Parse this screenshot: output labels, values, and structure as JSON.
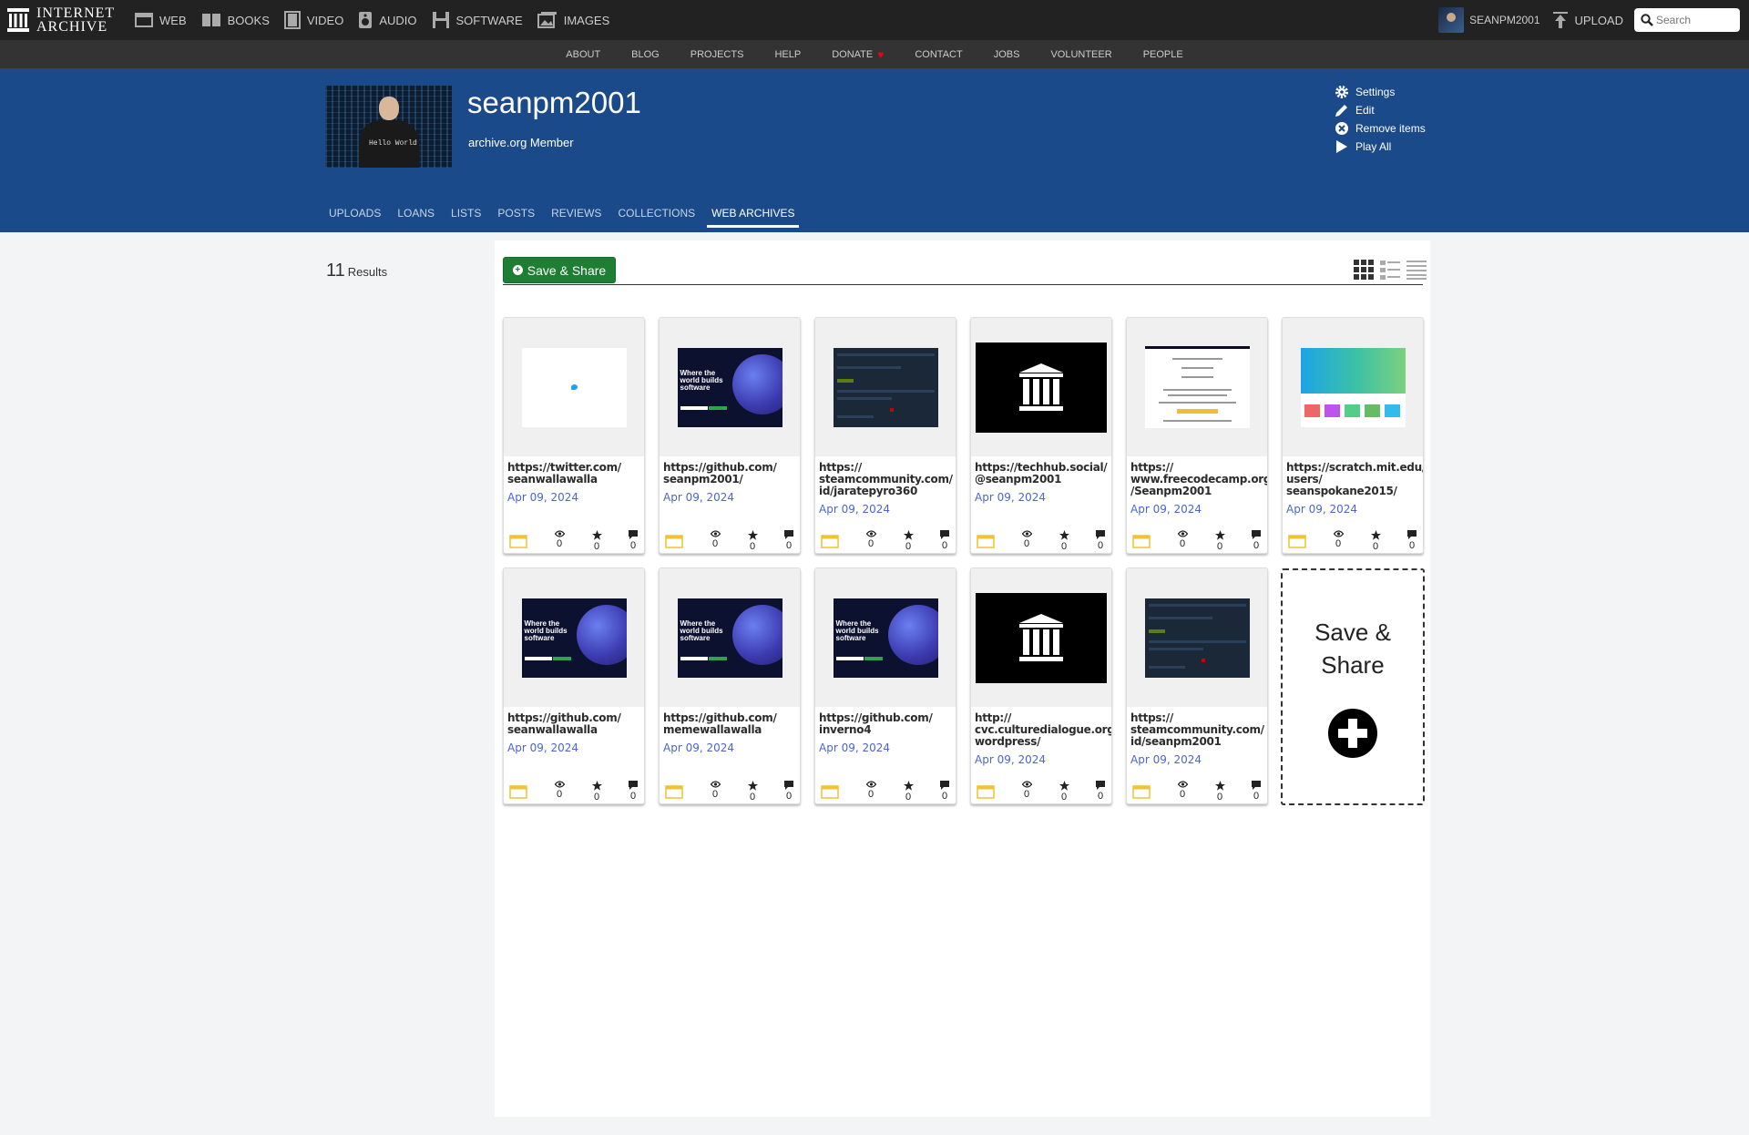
{
  "topnav": {
    "logo_line1": "INTERNET",
    "logo_line2": "ARCHIVE",
    "mediatypes": [
      {
        "label": "WEB",
        "icon": "web-icon"
      },
      {
        "label": "BOOKS",
        "icon": "books-icon"
      },
      {
        "label": "VIDEO",
        "icon": "video-icon"
      },
      {
        "label": "AUDIO",
        "icon": "audio-icon"
      },
      {
        "label": "SOFTWARE",
        "icon": "software-icon"
      },
      {
        "label": "IMAGES",
        "icon": "images-icon"
      }
    ],
    "username": "SEANPM2001",
    "upload_label": "UPLOAD",
    "search_placeholder": "Search"
  },
  "subnav": [
    "ABOUT",
    "BLOG",
    "PROJECTS",
    "HELP",
    "DONATE",
    "CONTACT",
    "JOBS",
    "VOLUNTEER",
    "PEOPLE"
  ],
  "profile": {
    "name": "seanpm2001",
    "subtitle": "archive.org Member",
    "photo_shirt_text": "Hello World",
    "actions": [
      {
        "label": "Settings",
        "icon": "gear-icon"
      },
      {
        "label": "Edit",
        "icon": "pencil-icon"
      },
      {
        "label": "Remove items",
        "icon": "remove-icon"
      },
      {
        "label": "Play All",
        "icon": "play-icon"
      }
    ]
  },
  "tabs": [
    {
      "label": "UPLOADS",
      "active": false
    },
    {
      "label": "LOANS",
      "active": false
    },
    {
      "label": "LISTS",
      "active": false
    },
    {
      "label": "POSTS",
      "active": false
    },
    {
      "label": "REVIEWS",
      "active": false
    },
    {
      "label": "COLLECTIONS",
      "active": false
    },
    {
      "label": "WEB ARCHIVES",
      "active": true
    }
  ],
  "results": {
    "count": "11",
    "label": "Results"
  },
  "toolbar": {
    "share_label": "Save & Share"
  },
  "items": [
    {
      "title": [
        "https://twitter.com/",
        "seanwallawalla"
      ],
      "date": "Apr 09, 2024",
      "thumb": "twitter",
      "views": "0",
      "favs": "0",
      "reviews": "0"
    },
    {
      "title": [
        "https://github.com/",
        "seanpm2001/"
      ],
      "date": "Apr 09, 2024",
      "thumb": "github",
      "thumb_text": "Where the world builds software",
      "views": "0",
      "favs": "0",
      "reviews": "0"
    },
    {
      "title": [
        "https://",
        "steamcommunity.com/",
        "id/jaratepyro360"
      ],
      "date": "Apr 09, 2024",
      "thumb": "steam",
      "views": "0",
      "favs": "0",
      "reviews": "0"
    },
    {
      "title": [
        "https://techhub.social/",
        "@seanpm2001"
      ],
      "date": "Apr 09, 2024",
      "thumb": "ia",
      "views": "0",
      "favs": "0",
      "reviews": "0"
    },
    {
      "title": [
        "https://",
        "www.freecodecamp.org",
        "/Seanpm2001"
      ],
      "date": "Apr 09, 2024",
      "thumb": "freecodecamp",
      "views": "0",
      "favs": "0",
      "reviews": "0"
    },
    {
      "title": [
        "https://scratch.mit.edu/",
        "users/",
        "seanspokane2015/"
      ],
      "date": "Apr 09, 2024",
      "thumb": "scratch",
      "views": "0",
      "favs": "0",
      "reviews": "0"
    },
    {
      "title": [
        "https://github.com/",
        "seanwallawalla"
      ],
      "date": "Apr 09, 2024",
      "thumb": "github",
      "thumb_text": "Where the world builds software",
      "views": "0",
      "favs": "0",
      "reviews": "0"
    },
    {
      "title": [
        "https://github.com/",
        "memewallawalla"
      ],
      "date": "Apr 09, 2024",
      "thumb": "github",
      "thumb_text": "Where the world builds software",
      "views": "0",
      "favs": "0",
      "reviews": "0"
    },
    {
      "title": [
        "https://github.com/",
        "inverno4"
      ],
      "date": "Apr 09, 2024",
      "thumb": "github",
      "thumb_text": "Where the world builds software",
      "views": "0",
      "favs": "0",
      "reviews": "0"
    },
    {
      "title": [
        "http://",
        "cvc.culturedialogue.org/",
        "wordpress/"
      ],
      "date": "Apr 09, 2024",
      "thumb": "ia",
      "views": "0",
      "favs": "0",
      "reviews": "0"
    },
    {
      "title": [
        "https://",
        "steamcommunity.com/",
        "id/seanpm2001"
      ],
      "date": "Apr 09, 2024",
      "thumb": "steam",
      "views": "0",
      "favs": "0",
      "reviews": "0"
    }
  ],
  "share_tile": {
    "line1": "Save &",
    "line2": "Share"
  },
  "colors": {
    "banner": "#1b4a8a",
    "topbar": "#222222",
    "subnav": "#333333",
    "share_green": "#1e7e34",
    "date_blue": "#4b64d7",
    "collection_icon": "#f1c232"
  }
}
